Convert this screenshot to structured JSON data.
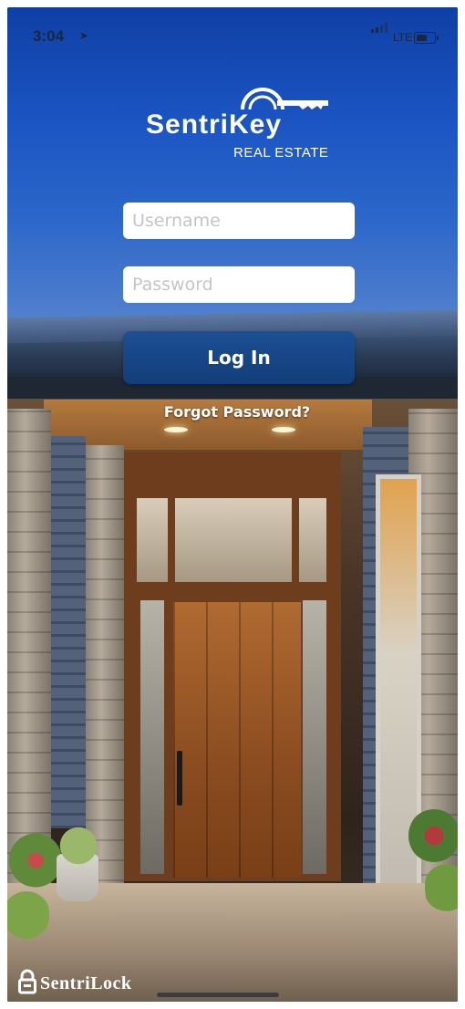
{
  "status_bar": {
    "time": "3:04",
    "location_icon": "location-arrow-icon",
    "carrier": "LTE",
    "signal_icon": "signal-bars-icon",
    "battery_icon": "battery-icon"
  },
  "brand": {
    "name": "SentriKey",
    "subtitle": "REAL ESTATE",
    "logo_icon": "key-icon"
  },
  "login_form": {
    "username_placeholder": "Username",
    "password_placeholder": "Password",
    "login_label": "Log In",
    "forgot_label": "Forgot Password?"
  },
  "footer": {
    "company": "SentriLock",
    "company_icon": "padlock-icon"
  },
  "colors": {
    "sky_top": "#0f3fa6",
    "button": "#1a4a8d",
    "field_bg": "#ffffff",
    "placeholder": "#c5c5c5",
    "text_white": "#ffffff"
  }
}
